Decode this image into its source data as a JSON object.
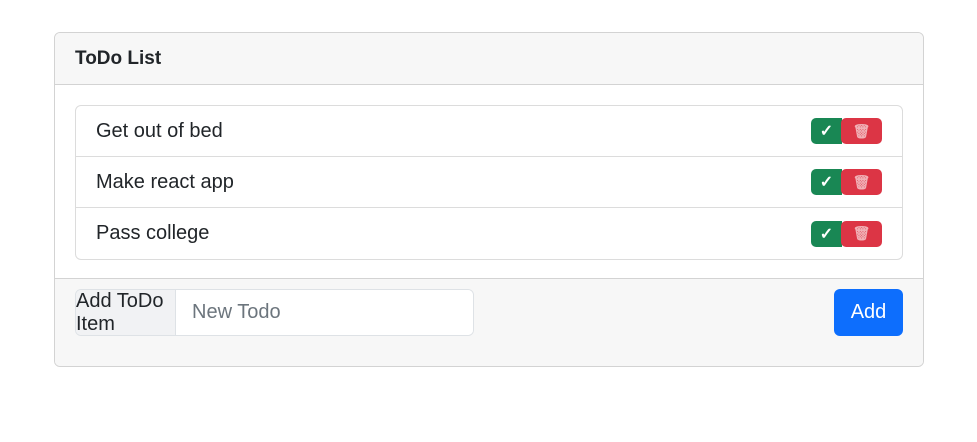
{
  "card": {
    "title": "ToDo List"
  },
  "todos": [
    {
      "text": "Get out of bed"
    },
    {
      "text": "Make react app"
    },
    {
      "text": "Pass college"
    }
  ],
  "actions": {
    "complete_glyph": "✓",
    "delete_glyph": "🗑",
    "complete_icon": "check-icon",
    "delete_icon": "trash-icon"
  },
  "footer": {
    "input_label": "Add ToDo Item",
    "input_placeholder": "New Todo",
    "input_value": "",
    "add_label": "Add"
  },
  "colors": {
    "success": "#198754",
    "danger": "#dc3545",
    "primary": "#0d6efd"
  }
}
